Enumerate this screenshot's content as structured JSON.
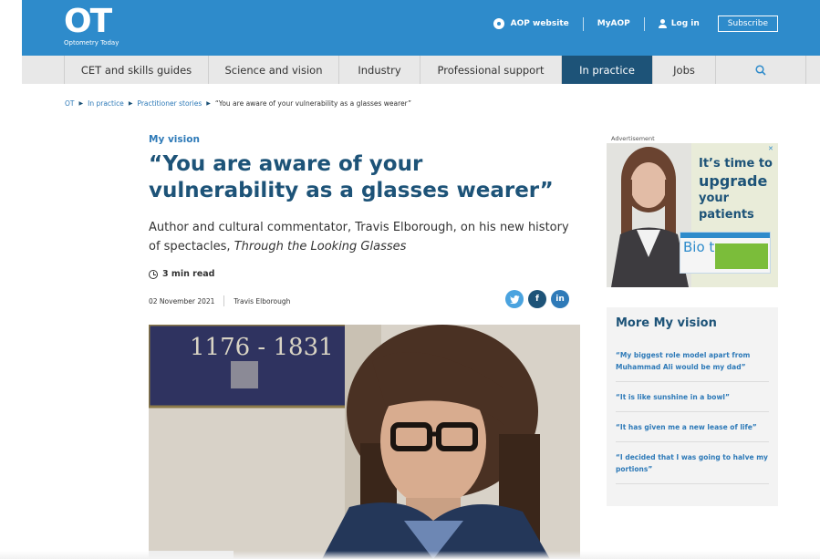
{
  "brand": {
    "logo": "OT",
    "name": "Optometry Today"
  },
  "top_links": {
    "aop": "AOP website",
    "myaop": "MyAOP",
    "login": "Log in",
    "subscribe": "Subscribe"
  },
  "nav": {
    "items": [
      {
        "label": "CET and skills guides"
      },
      {
        "label": "Science and vision"
      },
      {
        "label": "Industry"
      },
      {
        "label": "Professional support"
      },
      {
        "label": "In practice"
      },
      {
        "label": "Jobs"
      }
    ],
    "active": "In practice",
    "search_icon": "search-icon"
  },
  "breadcrumb": {
    "home": "OT",
    "level1": "In practice",
    "level2": "Practitioner stories",
    "current": "“You are aware of your vulnerability as a glasses wearer”"
  },
  "article": {
    "kicker": "My vision",
    "title": "“You are aware of your vulnerability as a glasses wearer”",
    "standfirst": "Author and cultural commentator, Travis Elborough, on his new history of spectacles, ",
    "standfirst_book": "Through the Looking Glasses",
    "read_time": "3 min read",
    "date": "02 November 2021",
    "author": "Travis Elborough",
    "share": {
      "twitter": "twitter-icon",
      "facebook": "facebook-icon",
      "linkedin": "linkedin-icon"
    },
    "photo_plaque": "1176 - 1831"
  },
  "advert": {
    "label": "Advertisement",
    "line1": "It’s time to",
    "line2": "upgrade",
    "line3": "your",
    "line4": "patients",
    "product": "Bio true"
  },
  "more": {
    "title": "More My vision",
    "items": [
      "“My biggest role model apart from Muhammad Ali would be my dad”",
      "“It is like sunshine in a bowl”",
      "“It has given me a new lease of life”",
      "“I decided that I was going to halve my portions”"
    ]
  },
  "colors": {
    "header_blue": "#2e8bcb",
    "nav_active": "#1d5378",
    "link": "#2e7ab8"
  }
}
